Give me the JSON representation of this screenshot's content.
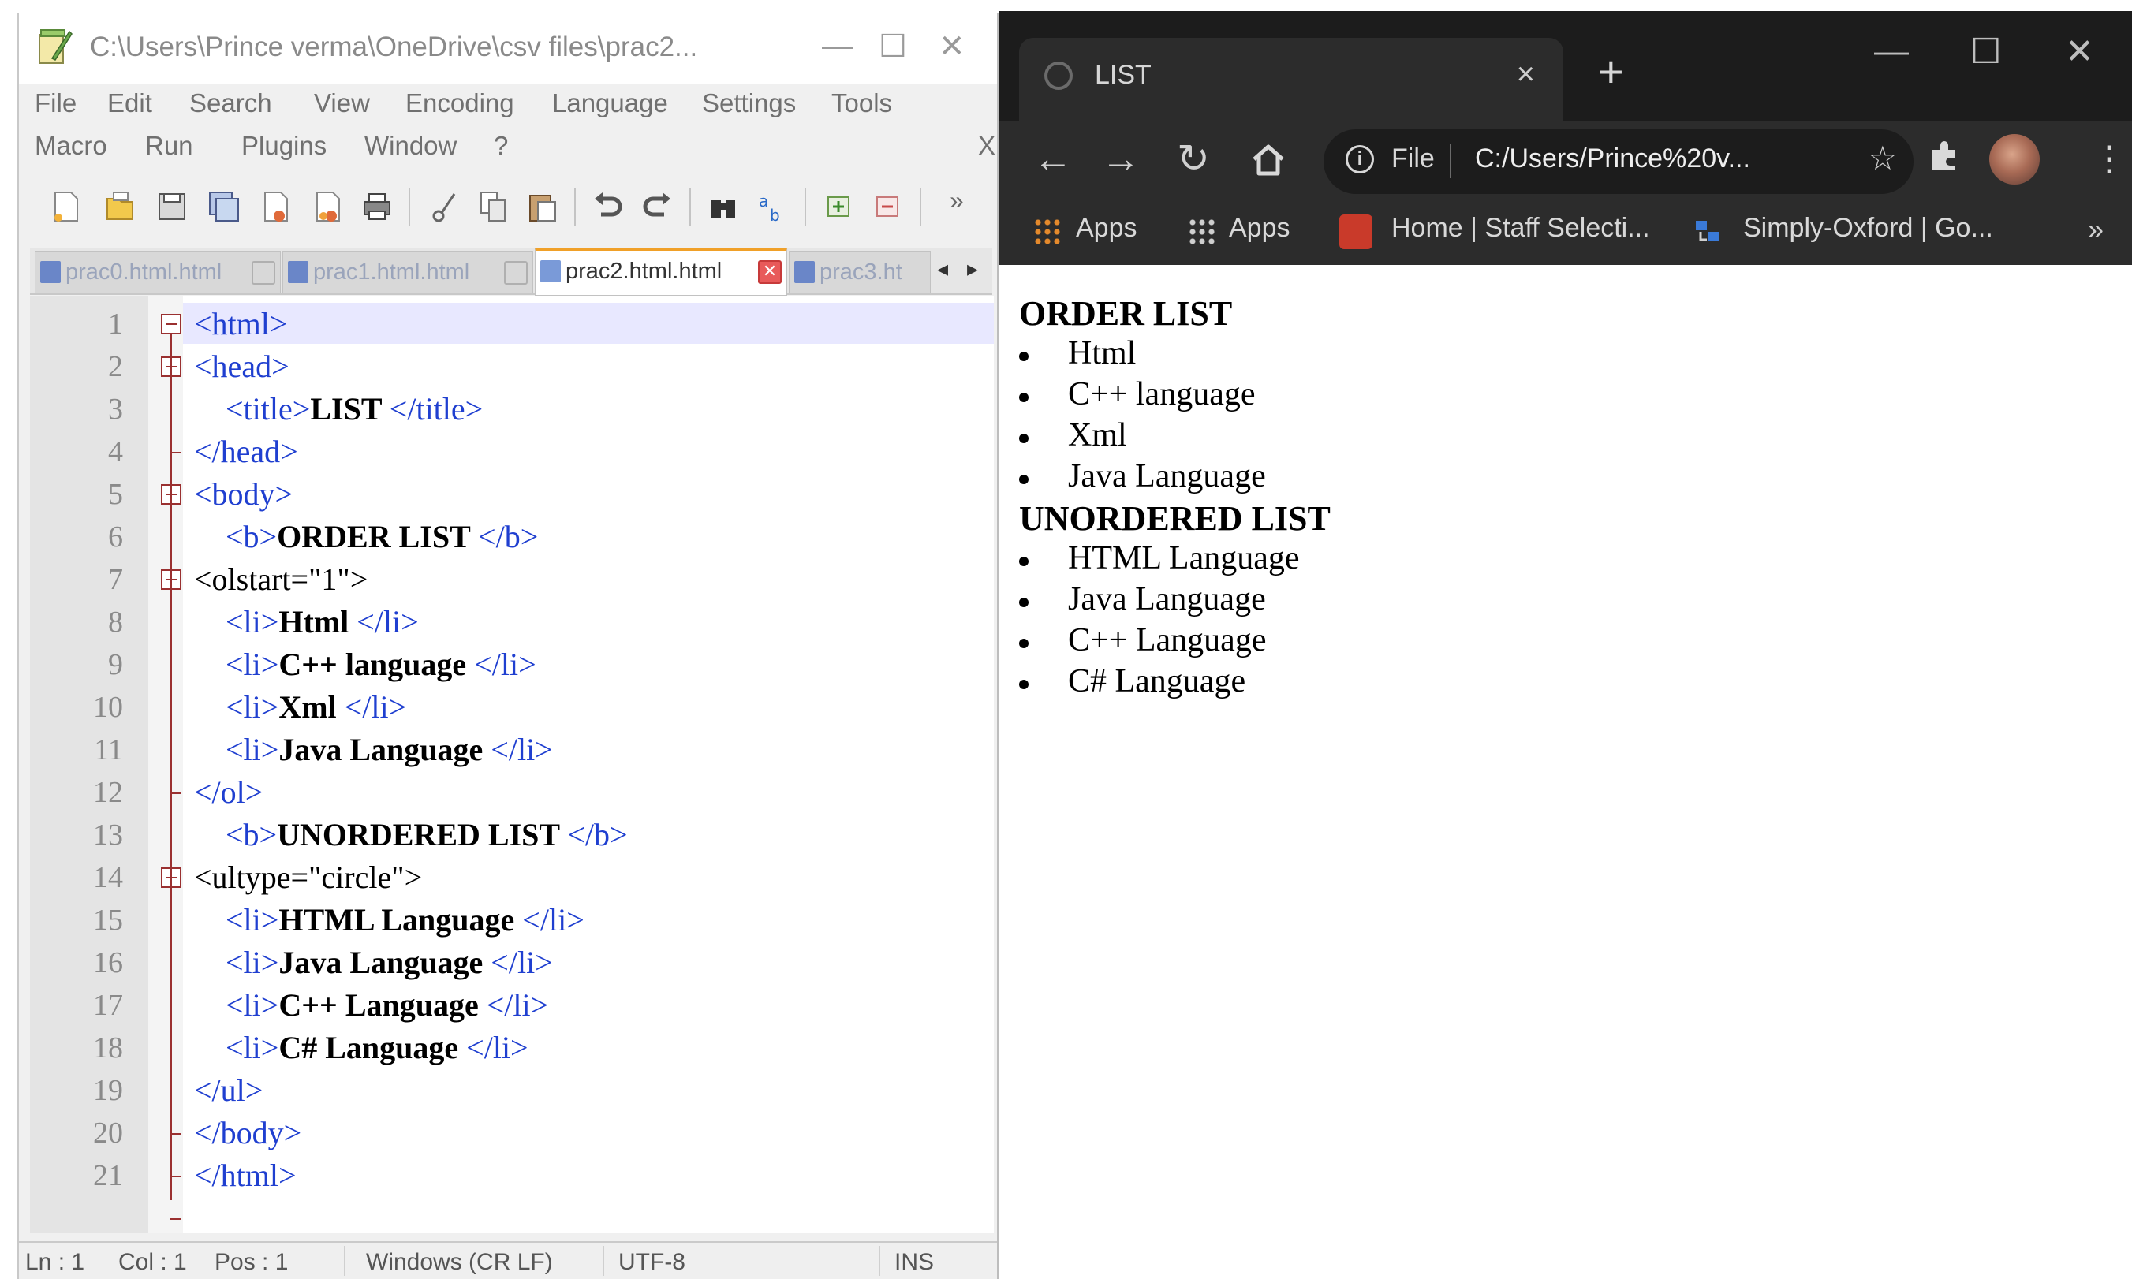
{
  "notepadpp": {
    "title": "C:\\Users\\Prince verma\\OneDrive\\csv files\\prac2...",
    "menu_row1": [
      "File",
      "Edit",
      "Search",
      "View",
      "Encoding",
      "Language",
      "Settings",
      "Tools"
    ],
    "menu_row2": [
      "Macro",
      "Run",
      "Plugins",
      "Window",
      "?"
    ],
    "menu_close": "X",
    "toolbar_overflow": "»",
    "tabs": [
      {
        "label": "prac0.html.html",
        "active": false
      },
      {
        "label": "prac1.html.html",
        "active": false
      },
      {
        "label": "prac2.html.html",
        "active": true
      },
      {
        "label": "prac3.ht",
        "active": false
      }
    ],
    "tab_scroll_left": "◂",
    "tab_scroll_right": "▸",
    "lines": [
      {
        "n": "1",
        "open": "<html>",
        "text": "",
        "close": ""
      },
      {
        "n": "2",
        "open": "<head>",
        "text": "",
        "close": ""
      },
      {
        "n": "3",
        "open": "<title>",
        "text": "LIST ",
        "close": "</title>"
      },
      {
        "n": "4",
        "open": "</head>",
        "text": "",
        "close": ""
      },
      {
        "n": "5",
        "open": "<body>",
        "text": "",
        "close": ""
      },
      {
        "n": "6",
        "open": "<b>",
        "text": "ORDER LIST ",
        "close": "</b>"
      },
      {
        "n": "7",
        "open": "<olstart=\"1\">",
        "text": "",
        "close": ""
      },
      {
        "n": "8",
        "open": "<li>",
        "text": "Html ",
        "close": "</li>"
      },
      {
        "n": "9",
        "open": "<li>",
        "text": "C++ language ",
        "close": "</li>"
      },
      {
        "n": "10",
        "open": "<li>",
        "text": "Xml ",
        "close": "</li>"
      },
      {
        "n": "11",
        "open": "<li>",
        "text": "Java Language ",
        "close": "</li>"
      },
      {
        "n": "12",
        "open": "</ol>",
        "text": "",
        "close": ""
      },
      {
        "n": "13",
        "open": "<b>",
        "text": "UNORDERED LIST ",
        "close": "</b>"
      },
      {
        "n": "14",
        "open": "<ultype=\"circle\">",
        "text": "",
        "close": ""
      },
      {
        "n": "15",
        "open": "<li>",
        "text": "HTML Language ",
        "close": "</li>"
      },
      {
        "n": "16",
        "open": "<li>",
        "text": "Java Language ",
        "close": "</li>"
      },
      {
        "n": "17",
        "open": "<li>",
        "text": "C++ Language ",
        "close": "</li>"
      },
      {
        "n": "18",
        "open": "<li>",
        "text": "C# Language ",
        "close": "</li>"
      },
      {
        "n": "19",
        "open": "</ul>",
        "text": "",
        "close": ""
      },
      {
        "n": "20",
        "open": "</body>",
        "text": "",
        "close": ""
      },
      {
        "n": "21",
        "open": "</html>",
        "text": "",
        "close": ""
      }
    ],
    "status": {
      "ln": "Ln : 1",
      "col": "Col : 1",
      "pos": "Pos : 1",
      "eol": "Windows (CR LF)",
      "encoding": "UTF-8",
      "mode": "INS"
    }
  },
  "chrome": {
    "tab_title": "LIST",
    "tab_close": "×",
    "new_tab": "+",
    "omnibox": {
      "scheme_label": "File",
      "url": "C:/Users/Prince%20v..."
    },
    "bookmarks": [
      {
        "label": "Apps",
        "icon": "apps-grid-icon"
      },
      {
        "label": "Apps",
        "icon": "apps-grid-icon"
      },
      {
        "label": "Home | Staff Selecti...",
        "icon": "ssc-icon"
      },
      {
        "label": "Simply-Oxford | Go...",
        "icon": "oxford-icon"
      }
    ],
    "bookmarks_more": "»",
    "page": {
      "ordered_heading": "ORDER LIST",
      "ordered_items": [
        "Html",
        "C++ language",
        "Xml",
        "Java Language"
      ],
      "unordered_heading": "UNORDERED LIST",
      "unordered_items": [
        "HTML Language",
        "Java Language",
        "C++ Language",
        "C# Language"
      ]
    }
  },
  "colors": {
    "tag_blue": "#1f3fd0",
    "active_tab_accent": "#f0a028",
    "chrome_dark": "#1c1c1c",
    "chrome_toolbar": "#2c2c2c"
  }
}
